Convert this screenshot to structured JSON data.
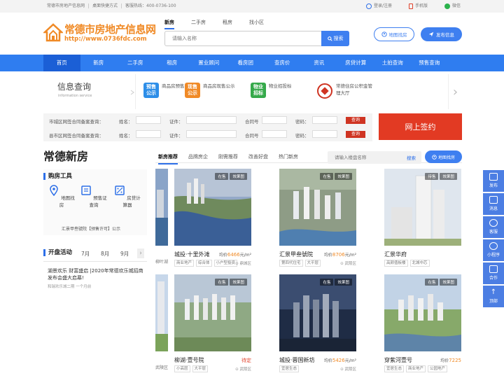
{
  "topbar": {
    "links": [
      "常德市房地产信息网",
      "桌面快捷方式",
      "客服热线：400-0736-100"
    ],
    "right": [
      {
        "label": "登录/注册",
        "icon": "user-icon",
        "color": "#2d6fe8"
      },
      {
        "label": "手机版",
        "icon": "phone-icon",
        "color": "#e0402a"
      },
      {
        "label": "微信",
        "icon": "wechat-icon",
        "color": "#2bb24c"
      }
    ]
  },
  "logo": {
    "title": "常德市房地产信息网",
    "url": "http://www.0736fdc.com"
  },
  "search": {
    "tabs": [
      "新房",
      "二手房",
      "租房",
      "找小区"
    ],
    "active_tab": "新房",
    "placeholder": "请输入名称",
    "button": "搜索"
  },
  "header_buttons": {
    "map": "地图找房",
    "publish": "发布信息"
  },
  "nav": {
    "items": [
      "首页",
      "新房",
      "二手房",
      "租房",
      "置业顾问",
      "看房团",
      "查房价",
      "资讯",
      "房贷计算",
      "土拍查询",
      "预售查询"
    ],
    "active": "首页"
  },
  "info_query": {
    "title": "信息查询",
    "subtitle": "information service",
    "items": [
      {
        "badge": "预售公示",
        "text": "商品房预售公示",
        "color": "#2d8ee8"
      },
      {
        "badge": "现售公示",
        "text": "商品房现售公示",
        "color": "#f08a26"
      },
      {
        "badge": "物业招标",
        "text": "物业招投标",
        "color": "#35a94a"
      },
      {
        "badge": "",
        "text": "常德住房公积金管理大厅",
        "color": "#cf3422"
      }
    ]
  },
  "backup_query": {
    "rows": [
      {
        "label": "市城区网签合同备案查询：",
        "f1": "姓名：",
        "f2": "证件：",
        "f3": "合同号",
        "f4": "密码：",
        "btn": "查询"
      },
      {
        "label": "县市区网签合同备案查询：",
        "f1": "姓名：",
        "f2": "证件：",
        "f3": "合同号",
        "f4": "密码：",
        "btn": "查询"
      }
    ],
    "sign_button": "网上签约"
  },
  "new_house": {
    "title": "常德新房",
    "tabs": [
      "新房推荐",
      "品牌房企",
      "刚需推荐",
      "改善好盘",
      "热门新房"
    ],
    "active_tab": "新房推荐",
    "search_placeholder": "请输入楼盘名称",
    "search_button": "搜索",
    "map_button": "地图找房"
  },
  "tools": {
    "title": "购房工具",
    "items": [
      {
        "label": "地图找房",
        "icon": "map-pin-icon"
      },
      {
        "label": "预售证查询",
        "icon": "certificate-icon"
      },
      {
        "label": "房贷计算器",
        "icon": "calculator-icon"
      }
    ],
    "news": "汇景甲叁號院【预售许可】公示"
  },
  "activity": {
    "title": "开盘活动",
    "months": [
      "7月",
      "8月",
      "9月"
    ],
    "item_title": "湖景欢乐 财富盛启 |2020年常德欢乐城招商发布会盛大启幕!",
    "item_meta": "和瑞欢乐城二期    一个月前"
  },
  "cards": [
    {
      "name": "城投·十里外滩",
      "status": "在售",
      "tag2": "效果图",
      "price_prefix": "均价",
      "price": "6466",
      "unit": "元/m²",
      "features": [
        "商业地产",
        "综合体",
        "小户型投资"
      ],
      "location": "鼎城区"
    },
    {
      "name": "汇景甲叁號院",
      "status": "在售",
      "tag2": "效果图",
      "price_prefix": "均价",
      "price": "8706",
      "unit": "元/m²",
      "features": [
        "第四代住宅",
        "大平层"
      ],
      "location": "武陵区"
    },
    {
      "name": "汇景华府",
      "status": "待售",
      "tag2": "效果图",
      "price_prefix": "",
      "price": "",
      "unit": "",
      "features": [
        "高颜值板楼",
        "北城中芯"
      ],
      "location": ""
    },
    {
      "name": "柳湖·壹号院",
      "status": "在售",
      "tag2": "效果图",
      "price_prefix": "",
      "price": "待定",
      "unit": "",
      "features": [
        "小高层",
        "大平层"
      ],
      "location": "武陵区"
    },
    {
      "name": "城投·蓉国新坊",
      "status": "在售",
      "tag2": "效果图",
      "price_prefix": "均价",
      "price": "5426",
      "unit": "元/m²",
      "features": [
        "宜居生态"
      ],
      "location": "武陵区"
    },
    {
      "name": "穿紫河壹号",
      "status": "在售",
      "tag2": "效果图",
      "price_prefix": "均价",
      "price": "7225",
      "unit": "",
      "features": [
        "宜居生态",
        "商业地产",
        "公园地产"
      ],
      "location": ""
    }
  ],
  "partial_cards": [
    {
      "tag": "在售",
      "text": "均价",
      "text2": "柳叶湖"
    },
    {
      "tag": "在售",
      "text": "均价",
      "text2": "武陵区"
    }
  ],
  "rail": [
    "发布",
    "消息",
    "客服",
    "小程序",
    "合作",
    "顶部"
  ]
}
